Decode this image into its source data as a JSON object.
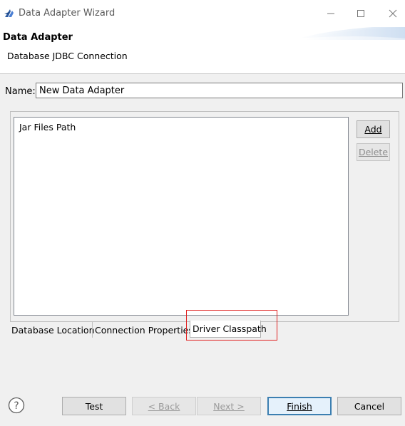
{
  "window": {
    "title": "Data Adapter Wizard",
    "icons": {
      "app": "eclipse-icon",
      "minimize": "minimize-icon",
      "maximize": "maximize-icon",
      "close": "close-icon"
    }
  },
  "header": {
    "title": "Data Adapter",
    "subtitle": "Database JDBC Connection"
  },
  "form": {
    "name_label": "Name:",
    "name_value": "New Data Adapter"
  },
  "classpath": {
    "column_header": "Jar Files Path",
    "add_label": "Add",
    "delete_label": "Delete"
  },
  "tabs": [
    {
      "label": "Database Location",
      "selected": false
    },
    {
      "label": "Connection Properties",
      "selected": false
    },
    {
      "label": "Driver Classpath",
      "selected": true
    }
  ],
  "footer": {
    "help_icon": "help-icon",
    "test_label": "Test",
    "back_label": "< Back",
    "next_label": "Next >",
    "finish_label": "Finish",
    "cancel_label": "Cancel"
  },
  "colors": {
    "accent": "#3c7fb1",
    "highlight": "#e02020",
    "banner": "#dfe9f5"
  }
}
